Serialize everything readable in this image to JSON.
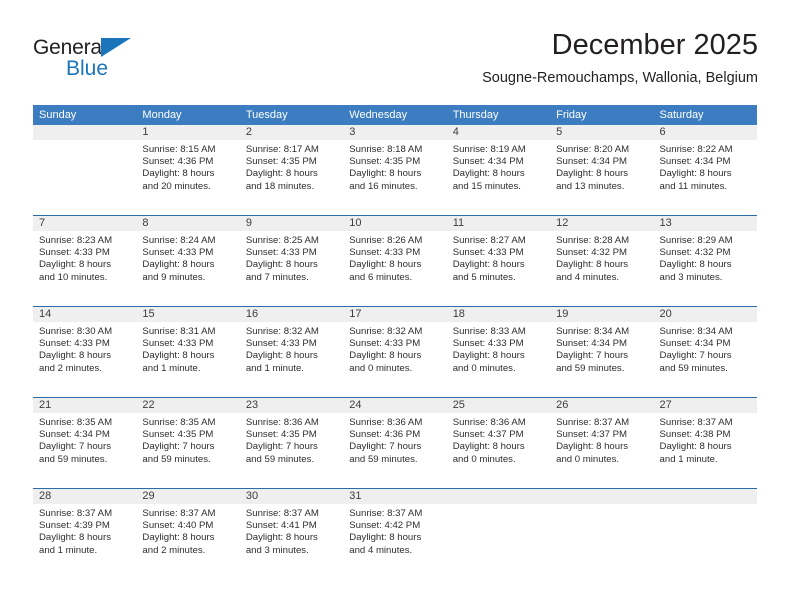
{
  "brand": {
    "name_top": "General",
    "name_bottom": "Blue",
    "triangle_icon": "triangle-icon",
    "accent_color": "#1b75bb"
  },
  "header": {
    "title": "December 2025",
    "subtitle": "Sougne-Remouchamps, Wallonia, Belgium"
  },
  "theme": {
    "header_band": "#3b7dc0",
    "row_divider": "#2b6ca8",
    "daynum_band": "#efefef",
    "text": "#231f20"
  },
  "weekdays": [
    "Sunday",
    "Monday",
    "Tuesday",
    "Wednesday",
    "Thursday",
    "Friday",
    "Saturday"
  ],
  "weeks": [
    [
      {
        "day": "",
        "sunrise": "",
        "sunset": "",
        "daylight_1": "",
        "daylight_2": ""
      },
      {
        "day": "1",
        "sunrise": "Sunrise: 8:15 AM",
        "sunset": "Sunset: 4:36 PM",
        "daylight_1": "Daylight: 8 hours",
        "daylight_2": "and 20 minutes."
      },
      {
        "day": "2",
        "sunrise": "Sunrise: 8:17 AM",
        "sunset": "Sunset: 4:35 PM",
        "daylight_1": "Daylight: 8 hours",
        "daylight_2": "and 18 minutes."
      },
      {
        "day": "3",
        "sunrise": "Sunrise: 8:18 AM",
        "sunset": "Sunset: 4:35 PM",
        "daylight_1": "Daylight: 8 hours",
        "daylight_2": "and 16 minutes."
      },
      {
        "day": "4",
        "sunrise": "Sunrise: 8:19 AM",
        "sunset": "Sunset: 4:34 PM",
        "daylight_1": "Daylight: 8 hours",
        "daylight_2": "and 15 minutes."
      },
      {
        "day": "5",
        "sunrise": "Sunrise: 8:20 AM",
        "sunset": "Sunset: 4:34 PM",
        "daylight_1": "Daylight: 8 hours",
        "daylight_2": "and 13 minutes."
      },
      {
        "day": "6",
        "sunrise": "Sunrise: 8:22 AM",
        "sunset": "Sunset: 4:34 PM",
        "daylight_1": "Daylight: 8 hours",
        "daylight_2": "and 11 minutes."
      }
    ],
    [
      {
        "day": "7",
        "sunrise": "Sunrise: 8:23 AM",
        "sunset": "Sunset: 4:33 PM",
        "daylight_1": "Daylight: 8 hours",
        "daylight_2": "and 10 minutes."
      },
      {
        "day": "8",
        "sunrise": "Sunrise: 8:24 AM",
        "sunset": "Sunset: 4:33 PM",
        "daylight_1": "Daylight: 8 hours",
        "daylight_2": "and 9 minutes."
      },
      {
        "day": "9",
        "sunrise": "Sunrise: 8:25 AM",
        "sunset": "Sunset: 4:33 PM",
        "daylight_1": "Daylight: 8 hours",
        "daylight_2": "and 7 minutes."
      },
      {
        "day": "10",
        "sunrise": "Sunrise: 8:26 AM",
        "sunset": "Sunset: 4:33 PM",
        "daylight_1": "Daylight: 8 hours",
        "daylight_2": "and 6 minutes."
      },
      {
        "day": "11",
        "sunrise": "Sunrise: 8:27 AM",
        "sunset": "Sunset: 4:33 PM",
        "daylight_1": "Daylight: 8 hours",
        "daylight_2": "and 5 minutes."
      },
      {
        "day": "12",
        "sunrise": "Sunrise: 8:28 AM",
        "sunset": "Sunset: 4:32 PM",
        "daylight_1": "Daylight: 8 hours",
        "daylight_2": "and 4 minutes."
      },
      {
        "day": "13",
        "sunrise": "Sunrise: 8:29 AM",
        "sunset": "Sunset: 4:32 PM",
        "daylight_1": "Daylight: 8 hours",
        "daylight_2": "and 3 minutes."
      }
    ],
    [
      {
        "day": "14",
        "sunrise": "Sunrise: 8:30 AM",
        "sunset": "Sunset: 4:33 PM",
        "daylight_1": "Daylight: 8 hours",
        "daylight_2": "and 2 minutes."
      },
      {
        "day": "15",
        "sunrise": "Sunrise: 8:31 AM",
        "sunset": "Sunset: 4:33 PM",
        "daylight_1": "Daylight: 8 hours",
        "daylight_2": "and 1 minute."
      },
      {
        "day": "16",
        "sunrise": "Sunrise: 8:32 AM",
        "sunset": "Sunset: 4:33 PM",
        "daylight_1": "Daylight: 8 hours",
        "daylight_2": "and 1 minute."
      },
      {
        "day": "17",
        "sunrise": "Sunrise: 8:32 AM",
        "sunset": "Sunset: 4:33 PM",
        "daylight_1": "Daylight: 8 hours",
        "daylight_2": "and 0 minutes."
      },
      {
        "day": "18",
        "sunrise": "Sunrise: 8:33 AM",
        "sunset": "Sunset: 4:33 PM",
        "daylight_1": "Daylight: 8 hours",
        "daylight_2": "and 0 minutes."
      },
      {
        "day": "19",
        "sunrise": "Sunrise: 8:34 AM",
        "sunset": "Sunset: 4:34 PM",
        "daylight_1": "Daylight: 7 hours",
        "daylight_2": "and 59 minutes."
      },
      {
        "day": "20",
        "sunrise": "Sunrise: 8:34 AM",
        "sunset": "Sunset: 4:34 PM",
        "daylight_1": "Daylight: 7 hours",
        "daylight_2": "and 59 minutes."
      }
    ],
    [
      {
        "day": "21",
        "sunrise": "Sunrise: 8:35 AM",
        "sunset": "Sunset: 4:34 PM",
        "daylight_1": "Daylight: 7 hours",
        "daylight_2": "and 59 minutes."
      },
      {
        "day": "22",
        "sunrise": "Sunrise: 8:35 AM",
        "sunset": "Sunset: 4:35 PM",
        "daylight_1": "Daylight: 7 hours",
        "daylight_2": "and 59 minutes."
      },
      {
        "day": "23",
        "sunrise": "Sunrise: 8:36 AM",
        "sunset": "Sunset: 4:35 PM",
        "daylight_1": "Daylight: 7 hours",
        "daylight_2": "and 59 minutes."
      },
      {
        "day": "24",
        "sunrise": "Sunrise: 8:36 AM",
        "sunset": "Sunset: 4:36 PM",
        "daylight_1": "Daylight: 7 hours",
        "daylight_2": "and 59 minutes."
      },
      {
        "day": "25",
        "sunrise": "Sunrise: 8:36 AM",
        "sunset": "Sunset: 4:37 PM",
        "daylight_1": "Daylight: 8 hours",
        "daylight_2": "and 0 minutes."
      },
      {
        "day": "26",
        "sunrise": "Sunrise: 8:37 AM",
        "sunset": "Sunset: 4:37 PM",
        "daylight_1": "Daylight: 8 hours",
        "daylight_2": "and 0 minutes."
      },
      {
        "day": "27",
        "sunrise": "Sunrise: 8:37 AM",
        "sunset": "Sunset: 4:38 PM",
        "daylight_1": "Daylight: 8 hours",
        "daylight_2": "and 1 minute."
      }
    ],
    [
      {
        "day": "28",
        "sunrise": "Sunrise: 8:37 AM",
        "sunset": "Sunset: 4:39 PM",
        "daylight_1": "Daylight: 8 hours",
        "daylight_2": "and 1 minute."
      },
      {
        "day": "29",
        "sunrise": "Sunrise: 8:37 AM",
        "sunset": "Sunset: 4:40 PM",
        "daylight_1": "Daylight: 8 hours",
        "daylight_2": "and 2 minutes."
      },
      {
        "day": "30",
        "sunrise": "Sunrise: 8:37 AM",
        "sunset": "Sunset: 4:41 PM",
        "daylight_1": "Daylight: 8 hours",
        "daylight_2": "and 3 minutes."
      },
      {
        "day": "31",
        "sunrise": "Sunrise: 8:37 AM",
        "sunset": "Sunset: 4:42 PM",
        "daylight_1": "Daylight: 8 hours",
        "daylight_2": "and 4 minutes."
      },
      {
        "day": "",
        "sunrise": "",
        "sunset": "",
        "daylight_1": "",
        "daylight_2": ""
      },
      {
        "day": "",
        "sunrise": "",
        "sunset": "",
        "daylight_1": "",
        "daylight_2": ""
      },
      {
        "day": "",
        "sunrise": "",
        "sunset": "",
        "daylight_1": "",
        "daylight_2": ""
      }
    ]
  ]
}
